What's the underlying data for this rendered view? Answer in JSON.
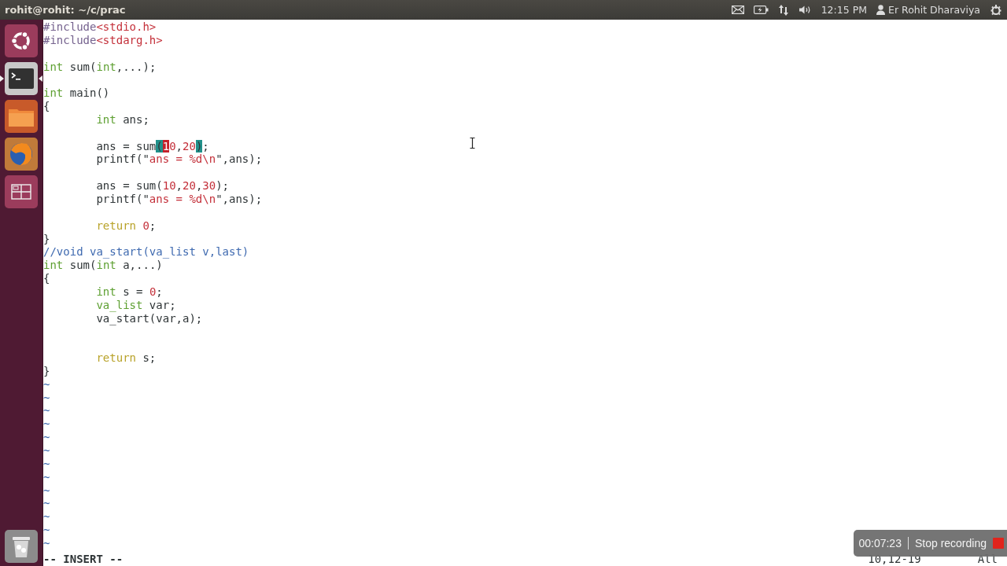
{
  "top_bar": {
    "title": "rohit@rohit: ~/c/prac",
    "time": "12:15 PM",
    "user": "Er Rohit Dharaviya"
  },
  "launcher": [
    {
      "kind": "ubuntu",
      "active": false
    },
    {
      "kind": "terminal",
      "active": true
    },
    {
      "kind": "files",
      "active": false
    },
    {
      "kind": "browser",
      "active": false
    },
    {
      "kind": "workspaces",
      "active": false
    },
    {
      "kind": "trash",
      "active": false
    }
  ],
  "editor": {
    "lines": [
      {
        "kind": "code",
        "indented": false,
        "tokens": [
          {
            "text": "#include",
            "kind": "preproc"
          },
          {
            "text": "<stdio.h>",
            "kind": "string"
          }
        ]
      },
      {
        "kind": "code",
        "indented": false,
        "tokens": [
          {
            "text": "#include",
            "kind": "preproc"
          },
          {
            "text": "<stdarg.h>",
            "kind": "string"
          }
        ]
      },
      {
        "kind": "blank"
      },
      {
        "kind": "code",
        "indented": false,
        "tokens": [
          {
            "text": "int",
            "kind": "type"
          },
          {
            "text": " sum(",
            "kind": "plain"
          },
          {
            "text": "int",
            "kind": "type"
          },
          {
            "text": ",...);",
            "kind": "plain"
          }
        ]
      },
      {
        "kind": "blank"
      },
      {
        "kind": "code",
        "indented": false,
        "tokens": [
          {
            "text": "int",
            "kind": "type"
          },
          {
            "text": " main()",
            "kind": "plain"
          }
        ]
      },
      {
        "kind": "code",
        "indented": false,
        "tokens": [
          {
            "text": "{",
            "kind": "plain"
          }
        ]
      },
      {
        "kind": "code",
        "indented": true,
        "tokens": [
          {
            "text": "int",
            "kind": "type"
          },
          {
            "text": " ans;",
            "kind": "plain"
          }
        ]
      },
      {
        "kind": "blank"
      },
      {
        "kind": "code",
        "indented": true,
        "tokens": [
          {
            "text": "ans = sum",
            "kind": "plain"
          },
          {
            "text": "(",
            "kind": "match"
          },
          {
            "text": "1",
            "kind": "cursor"
          },
          {
            "text": "0",
            "kind": "number"
          },
          {
            "text": ",",
            "kind": "plain"
          },
          {
            "text": "20",
            "kind": "number"
          },
          {
            "text": ")",
            "kind": "match"
          },
          {
            "text": ";",
            "kind": "plain"
          }
        ]
      },
      {
        "kind": "code",
        "indented": true,
        "tokens": [
          {
            "text": "printf(\"",
            "kind": "plain"
          },
          {
            "text": "ans = %d\\n",
            "kind": "string"
          },
          {
            "text": "\",ans);",
            "kind": "plain"
          }
        ]
      },
      {
        "kind": "blank"
      },
      {
        "kind": "code",
        "indented": true,
        "tokens": [
          {
            "text": "ans = sum(",
            "kind": "plain"
          },
          {
            "text": "10",
            "kind": "number"
          },
          {
            "text": ",",
            "kind": "plain"
          },
          {
            "text": "20",
            "kind": "number"
          },
          {
            "text": ",",
            "kind": "plain"
          },
          {
            "text": "30",
            "kind": "number"
          },
          {
            "text": ");",
            "kind": "plain"
          }
        ]
      },
      {
        "kind": "code",
        "indented": true,
        "tokens": [
          {
            "text": "printf(\"",
            "kind": "plain"
          },
          {
            "text": "ans = %d\\n",
            "kind": "string"
          },
          {
            "text": "\",ans);",
            "kind": "plain"
          }
        ]
      },
      {
        "kind": "blank"
      },
      {
        "kind": "code",
        "indented": true,
        "tokens": [
          {
            "text": "return",
            "kind": "keyword"
          },
          {
            "text": " 0",
            "kind": "number"
          },
          {
            "text": ";",
            "kind": "plain"
          }
        ]
      },
      {
        "kind": "code",
        "indented": false,
        "tokens": [
          {
            "text": "}",
            "kind": "plain"
          }
        ]
      },
      {
        "kind": "code",
        "indented": false,
        "tokens": [
          {
            "text": "//void va_start(va_list v,last)",
            "kind": "comment"
          }
        ]
      },
      {
        "kind": "code",
        "indented": false,
        "tokens": [
          {
            "text": "int",
            "kind": "type"
          },
          {
            "text": " sum(",
            "kind": "plain"
          },
          {
            "text": "int",
            "kind": "type"
          },
          {
            "text": " a,...)",
            "kind": "plain"
          }
        ]
      },
      {
        "kind": "code",
        "indented": false,
        "tokens": [
          {
            "text": "{",
            "kind": "plain"
          }
        ]
      },
      {
        "kind": "code",
        "indented": true,
        "tokens": [
          {
            "text": "int",
            "kind": "type"
          },
          {
            "text": " s = ",
            "kind": "plain"
          },
          {
            "text": "0",
            "kind": "number"
          },
          {
            "text": ";",
            "kind": "plain"
          }
        ]
      },
      {
        "kind": "code",
        "indented": true,
        "tokens": [
          {
            "text": "va_list",
            "kind": "type"
          },
          {
            "text": " var;",
            "kind": "plain"
          }
        ]
      },
      {
        "kind": "code",
        "indented": true,
        "tokens": [
          {
            "text": "va_start(var,a);",
            "kind": "plain"
          }
        ]
      },
      {
        "kind": "blank"
      },
      {
        "kind": "blank"
      },
      {
        "kind": "code",
        "indented": true,
        "tokens": [
          {
            "text": "return",
            "kind": "keyword"
          },
          {
            "text": " s;",
            "kind": "plain"
          }
        ]
      },
      {
        "kind": "code",
        "indented": false,
        "tokens": [
          {
            "text": "}",
            "kind": "plain"
          }
        ]
      }
    ],
    "tildes": [
      "~",
      "~",
      "~",
      "~",
      "~",
      "~",
      "~",
      "~",
      "~",
      "~",
      "~",
      "~",
      "~"
    ],
    "mode": "-- INSERT --",
    "position": "10,12-19",
    "scroll": "All"
  },
  "recorder": {
    "elapsed": "00:07:23",
    "action": "Stop recording"
  }
}
